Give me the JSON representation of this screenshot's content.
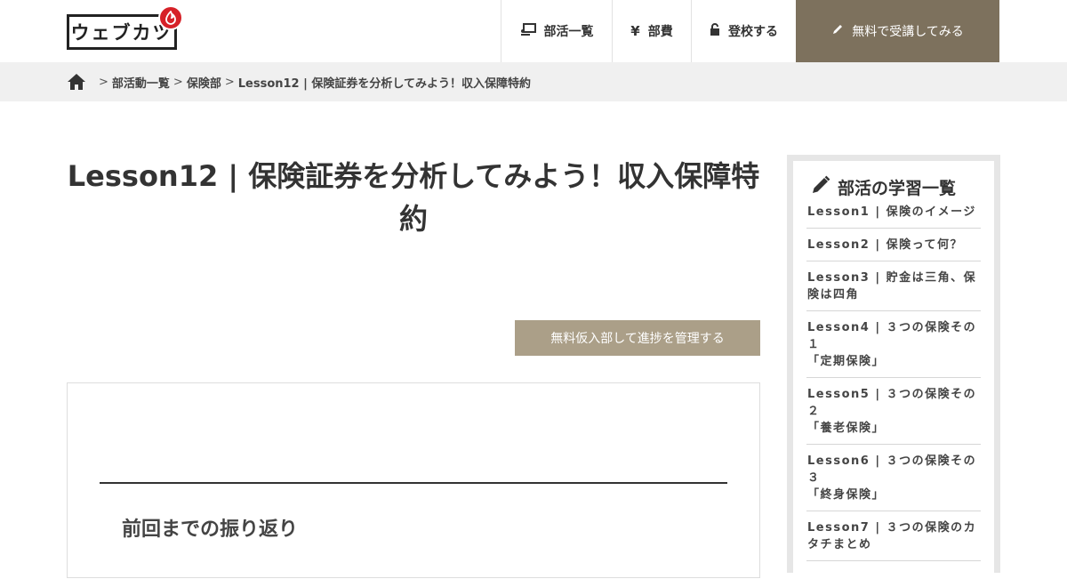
{
  "brand": {
    "logo_text": "ウェブカツ"
  },
  "nav": {
    "items": [
      {
        "label": "部活一覧",
        "icon": "laptop-icon"
      },
      {
        "label": "部費",
        "icon": "yen-icon"
      },
      {
        "label": "登校する",
        "icon": "unlock-icon"
      }
    ],
    "cta": {
      "label": "無料で受講してみる",
      "icon": "pencil-icon"
    }
  },
  "breadcrumb": {
    "sep": ">",
    "items": [
      "部活動一覧",
      "保険部",
      "Lesson12 | 保険証券を分析してみよう！収入保障特約"
    ]
  },
  "main": {
    "title": "Lesson12 | 保険証券を分析してみよう！収入保障特約",
    "join_button": "無料仮入部して進捗を管理する",
    "section_heading": "前回までの振り返り"
  },
  "sidebar": {
    "title": "部活の学習一覧",
    "items": [
      "Lesson1 | 保険のイメージ",
      "Lesson2 | 保険って何？",
      "Lesson3 | 貯金は三角、保険は四角",
      "Lesson4 | ３つの保険その１\n「定期保険」",
      "Lesson5 | ３つの保険その２\n「養老保険」",
      "Lesson6 | ３つの保険その３\n「終身保険」",
      "Lesson7 | ３つの保険のカタチまとめ"
    ]
  },
  "colors": {
    "cta_bg": "#7d715d",
    "join_bg": "#ab9f88",
    "brand_red": "#d62128",
    "crumb_bg": "#f0f0f0"
  }
}
